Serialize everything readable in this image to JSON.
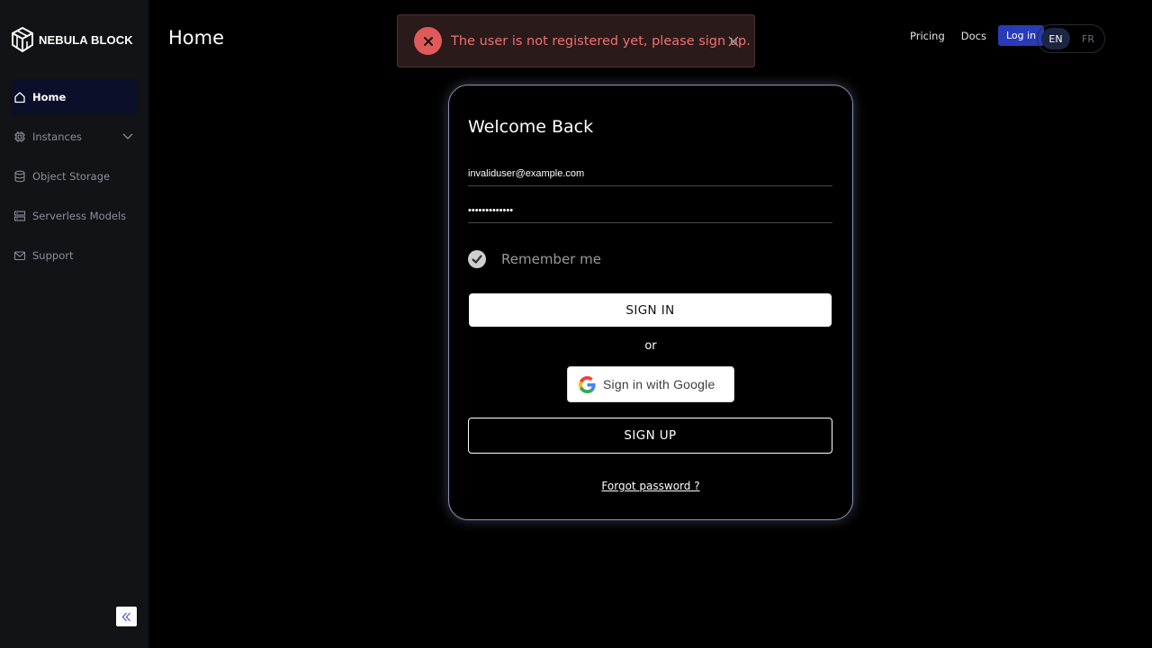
{
  "brand": {
    "name": "NEBULA BLOCK",
    "logo_icon": "cube-logo-icon"
  },
  "sidebar": {
    "items": [
      {
        "label": "Home",
        "icon": "home-icon",
        "active": true
      },
      {
        "label": "Instances",
        "icon": "chip-icon",
        "expandable": true
      },
      {
        "label": "Object Storage",
        "icon": "database-icon"
      },
      {
        "label": "Serverless Models",
        "icon": "server-icon"
      },
      {
        "label": "Support",
        "icon": "mail-icon"
      }
    ],
    "collapse_icon": "double-chevron-left-icon"
  },
  "header": {
    "title": "Home",
    "nav": {
      "pricing": "Pricing",
      "docs": "Docs",
      "login": "Log in"
    },
    "languages": {
      "selected": "EN",
      "other": "FR"
    }
  },
  "toast": {
    "message": "The user is not registered yet, please sign up.",
    "type": "error",
    "color": "#e05a5a"
  },
  "login_card": {
    "title": "Welcome Back",
    "email_value": "invaliduser@example.com",
    "password_value": "•••••••••••••",
    "remember_label": "Remember me",
    "remember_checked": true,
    "signin_label": "SIGN IN",
    "or_label": "or",
    "google_label": "Sign in with Google",
    "signup_label": "SIGN UP",
    "forgot_label": "Forgot password ?"
  },
  "colors": {
    "accent": "#2a3bb8",
    "background": "#000000",
    "sidebar_bg": "#121316",
    "card_border": "#8892b8"
  }
}
